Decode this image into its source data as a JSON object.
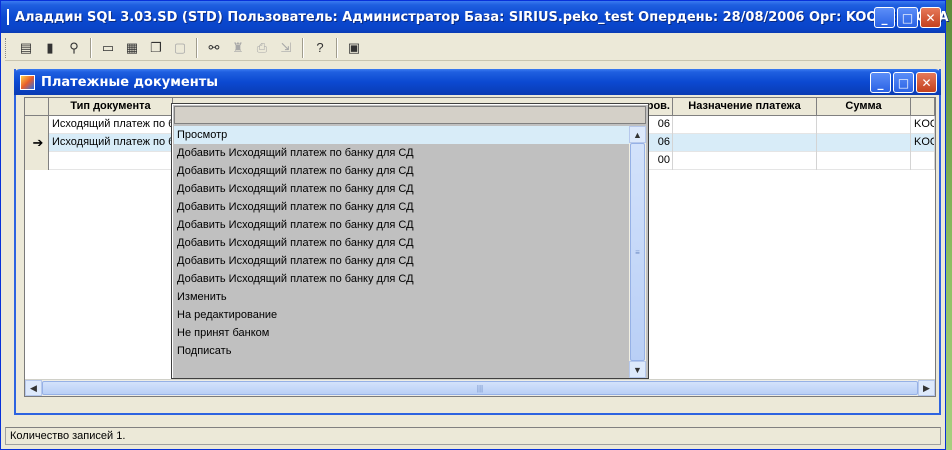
{
  "app": {
    "title": "Аладдин SQL 3.03.SD (STD)  Пользователь: Администратор База: SIRIUS.peko_test Опердень: 28/08/2006 Орг: KOOPERACIYA",
    "icon": "app-logo-icon"
  },
  "window_buttons": {
    "minimize": "_",
    "maximize": "□",
    "close": "✕"
  },
  "toolbar": {
    "buttons": [
      {
        "icon": "document-icon",
        "glyph": "▤"
      },
      {
        "icon": "database-icon",
        "glyph": "▮"
      },
      {
        "icon": "find-user-icon",
        "glyph": "⚲"
      },
      {
        "icon": "window-icon",
        "glyph": "▭"
      },
      {
        "icon": "tile-icon",
        "glyph": "▦"
      },
      {
        "icon": "cascade-icon",
        "glyph": "❐"
      },
      {
        "icon": "monitor-icon",
        "glyph": "▢"
      },
      {
        "icon": "binoculars-icon",
        "glyph": "⚯"
      },
      {
        "icon": "stamp-icon",
        "glyph": "♜"
      },
      {
        "icon": "print-icon",
        "glyph": "⎙"
      },
      {
        "icon": "export-icon",
        "glyph": "⇲"
      },
      {
        "icon": "help-icon",
        "glyph": "?"
      },
      {
        "icon": "chip-icon",
        "glyph": "▣"
      }
    ]
  },
  "child": {
    "title": "Платежные документы"
  },
  "grid": {
    "columns": [
      "Тип документа",
      "ров.",
      "Назначение платежа",
      "Сумма"
    ],
    "rows": [
      {
        "indicator": "",
        "type": "Исходящий платеж по б",
        "date": "06",
        "purpose": "",
        "sum": "",
        "org": "KOO"
      },
      {
        "indicator": "➔",
        "type": "Исходящий платеж по б",
        "date": "06",
        "purpose": "",
        "sum": "",
        "org": "KOO"
      },
      {
        "indicator": "",
        "type": "",
        "date": "00",
        "purpose": "",
        "sum": "",
        "org": ""
      }
    ]
  },
  "dropdown": {
    "items": [
      "Просмотр",
      "Добавить Исходящий платеж по банку для СД",
      "Добавить Исходящий платеж по банку для СД",
      "Добавить Исходящий платеж по банку для СД",
      "Добавить Исходящий платеж по банку для СД",
      "Добавить Исходящий платеж по банку для СД",
      "Добавить Исходящий платеж по банку для СД",
      "Добавить Исходящий платеж по банку для СД",
      "Добавить Исходящий платеж по банку для СД",
      "Изменить",
      "На редактирование",
      "Не принят банком",
      "Подписать"
    ]
  },
  "status": {
    "text": "Количество записей 1."
  },
  "colors": {
    "titlebar": "#0b49d1",
    "selection": "#d8ecf8",
    "dropdown_bg": "#c0c0c0"
  }
}
